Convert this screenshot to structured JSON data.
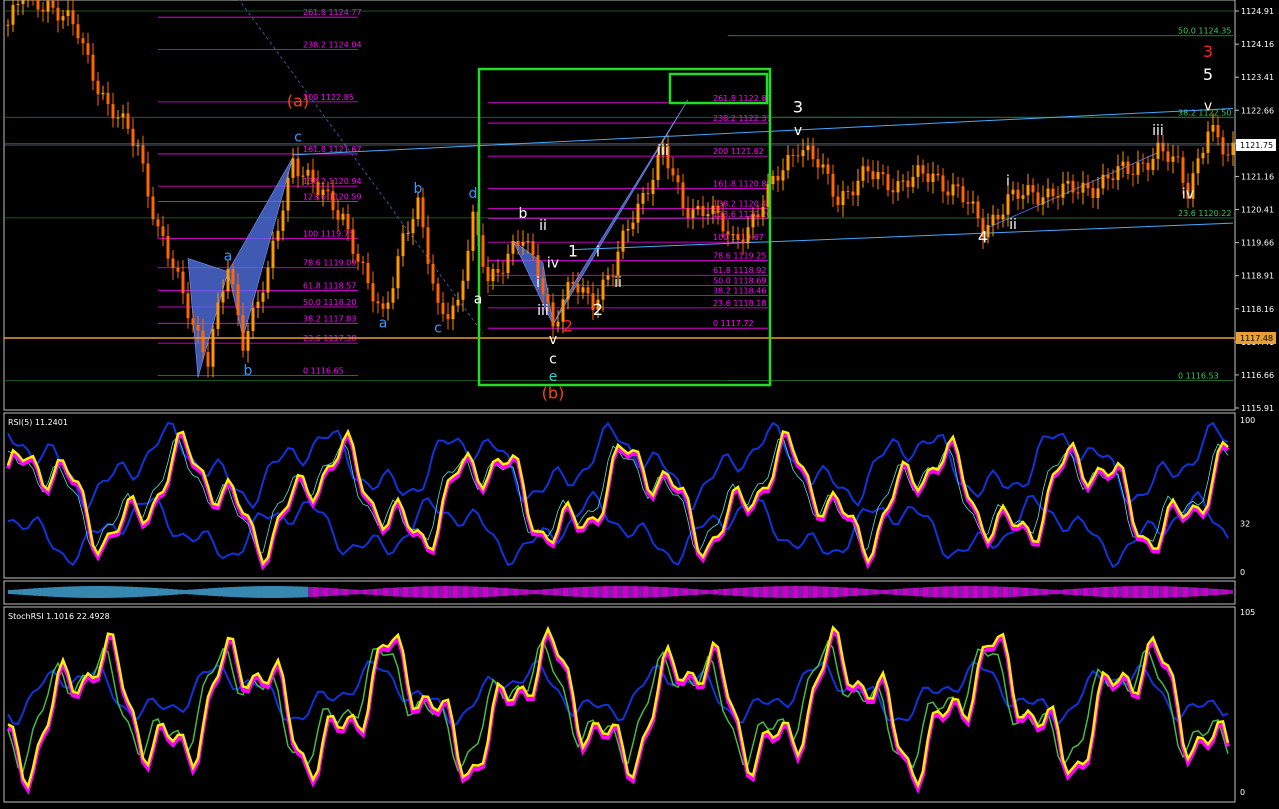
{
  "chart_data": [
    {
      "panel": "price",
      "type": "candlestick",
      "title": "",
      "y_axis_ticks": [
        "1124.91",
        "1124.16",
        "1123.41",
        "1122.66",
        "1121.91",
        "1121.16",
        "1120.41",
        "1119.66",
        "1118.91",
        "1118.16",
        "1117.41",
        "1116.66",
        "1115.91"
      ],
      "ylim": [
        1115.91,
        1125.16
      ],
      "current_price_label": "1121.75",
      "horizontal_level_label": "1117.48",
      "fib_sets": [
        {
          "name": "left",
          "levels": [
            {
              "text": "261.8 1124.77",
              "price": 1124.77
            },
            {
              "text": "238.2 1124.04",
              "price": 1124.04
            },
            {
              "text": "200 1122.85",
              "price": 1122.85
            },
            {
              "text": "161.8 1121.67",
              "price": 1121.67
            },
            {
              "text": "138.2 1120.94",
              "price": 1120.94
            },
            {
              "text": "123.6 1120.59",
              "price": 1120.59
            },
            {
              "text": "100 1119.75",
              "price": 1119.75
            },
            {
              "text": "78.6 1119.09",
              "price": 1119.09
            },
            {
              "text": "61.8 1118.57",
              "price": 1118.57
            },
            {
              "text": "50.0 1118.20",
              "price": 1118.2
            },
            {
              "text": "38.2 1117.83",
              "price": 1117.83
            },
            {
              "text": "23.6 1117.38",
              "price": 1117.38
            },
            {
              "text": "0 1116.65",
              "price": 1116.65
            }
          ]
        },
        {
          "name": "middle",
          "levels": [
            {
              "text": "261.8 1122.83",
              "price": 1122.83
            },
            {
              "text": "238.2 1122.37",
              "price": 1122.37
            },
            {
              "text": "200 1121.62",
              "price": 1121.62
            },
            {
              "text": "161.8 1120.89",
              "price": 1120.89
            },
            {
              "text": "138.2 1120.43",
              "price": 1120.43
            },
            {
              "text": "123.6 1120.20",
              "price": 1120.2
            },
            {
              "text": "100 1119.67",
              "price": 1119.67
            },
            {
              "text": "78.6 1119.25",
              "price": 1119.25
            },
            {
              "text": "61.8 1118.92",
              "price": 1118.92
            },
            {
              "text": "50.0 1118.69",
              "price": 1118.69
            },
            {
              "text": "38.2 1118.46",
              "price": 1118.46
            },
            {
              "text": "23.6 1118.18",
              "price": 1118.18
            },
            {
              "text": "0 1117.72",
              "price": 1117.72
            }
          ]
        },
        {
          "name": "right",
          "levels": [
            {
              "text": "50.0 1124.35",
              "price": 1124.35
            },
            {
              "text": "38.2 1122.50",
              "price": 1122.5
            },
            {
              "text": "23.6 1120.22",
              "price": 1120.22
            },
            {
              "text": "0 1116.53",
              "price": 1116.53
            }
          ]
        }
      ],
      "wave_labels": [
        {
          "text": "(a)",
          "color": "#ff4400",
          "bar": 58,
          "price": 1122.75
        },
        {
          "text": "c",
          "color": "#3399ff",
          "bar": 58,
          "price": 1121.95
        },
        {
          "text": "a",
          "color": "#3399ff",
          "bar": 44,
          "price": 1119.25
        },
        {
          "text": "b",
          "color": "#3399ff",
          "bar": 48,
          "price": 1116.66
        },
        {
          "text": "b",
          "color": "#3399ff",
          "bar": 82,
          "price": 1120.78
        },
        {
          "text": "a",
          "color": "#3399ff",
          "bar": 75,
          "price": 1117.73
        },
        {
          "text": "c",
          "color": "#3399ff",
          "bar": 86,
          "price": 1117.62
        },
        {
          "text": "d",
          "color": "#3399ff",
          "bar": 93,
          "price": 1120.67
        },
        {
          "text": "a",
          "color": "#ffffff",
          "bar": 94,
          "price": 1118.28
        },
        {
          "text": "b",
          "color": "#ffffff",
          "bar": 103,
          "price": 1120.22
        },
        {
          "text": "ii",
          "color": "#ffffff",
          "bar": 107,
          "price": 1119.95
        },
        {
          "text": "iv",
          "color": "#ffffff",
          "bar": 109,
          "price": 1119.1
        },
        {
          "text": "i",
          "color": "#ffffff",
          "bar": 106,
          "price": 1118.65
        },
        {
          "text": "iii",
          "color": "#ffffff",
          "bar": 107,
          "price": 1118.02
        },
        {
          "text": "1",
          "color": "#ffffff",
          "bar": 113,
          "price": 1119.35
        },
        {
          "text": "i",
          "color": "#ffffff",
          "bar": 118,
          "price": 1119.35
        },
        {
          "text": "ii",
          "color": "#ffffff",
          "bar": 122,
          "price": 1118.65
        },
        {
          "text": "2",
          "color": "#ffffff",
          "bar": 118,
          "price": 1118.02
        },
        {
          "text": "2",
          "color": "#ff2222",
          "bar": 112,
          "price": 1117.64
        },
        {
          "text": "v",
          "color": "#ffffff",
          "bar": 109,
          "price": 1117.36
        },
        {
          "text": "c",
          "color": "#ffffff",
          "bar": 109,
          "price": 1116.92
        },
        {
          "text": "e",
          "color": "#33cccc",
          "bar": 109,
          "price": 1116.52
        },
        {
          "text": "(b)",
          "color": "#ff4400",
          "bar": 109,
          "price": 1116.12
        },
        {
          "text": "iii",
          "color": "#ffffff",
          "bar": 131,
          "price": 1121.65
        },
        {
          "text": "3",
          "color": "#ffffff",
          "bar": 158,
          "price": 1122.61
        },
        {
          "text": "v",
          "color": "#ffffff",
          "bar": 158,
          "price": 1122.1
        },
        {
          "text": "i",
          "color": "#ffffff",
          "bar": 200,
          "price": 1120.96
        },
        {
          "text": "ii",
          "color": "#ffffff",
          "bar": 201,
          "price": 1119.97
        },
        {
          "text": "4",
          "color": "#ffffff",
          "bar": 195,
          "price": 1119.66
        },
        {
          "text": "iii",
          "color": "#ffffff",
          "bar": 230,
          "price": 1122.1
        },
        {
          "text": "iv",
          "color": "#ffffff",
          "bar": 236,
          "price": 1120.66
        },
        {
          "text": "3",
          "color": "#ff2222",
          "bar": 240,
          "price": 1123.87
        },
        {
          "text": "5",
          "color": "#ffffff",
          "bar": 240,
          "price": 1123.35
        },
        {
          "text": "v",
          "color": "#ffffff",
          "bar": 240,
          "price": 1122.66
        }
      ]
    },
    {
      "panel": "rsi",
      "type": "line",
      "title": "RSI(5) 11.2401",
      "y_axis_ticks": [
        "100",
        "32",
        "0"
      ]
    },
    {
      "panel": "histogram",
      "type": "area",
      "title": ""
    },
    {
      "panel": "stoch",
      "type": "line",
      "title": "StochRSI 1.1016 22.4928",
      "y_axis_ticks": [
        "105",
        "0"
      ]
    }
  ],
  "colors": {
    "background": "#000000",
    "candle_up": "#ff9900",
    "candle_down": "#ff6600",
    "fib": "#ff00ff",
    "pattern_fill": "#5577ee",
    "box": "#22dd22",
    "trendline": "#44aaff",
    "level_line": "#e8a030",
    "rsi_main": "#ffee00",
    "rsi_shadow": "#ff00ff",
    "band": "#1133dd"
  }
}
